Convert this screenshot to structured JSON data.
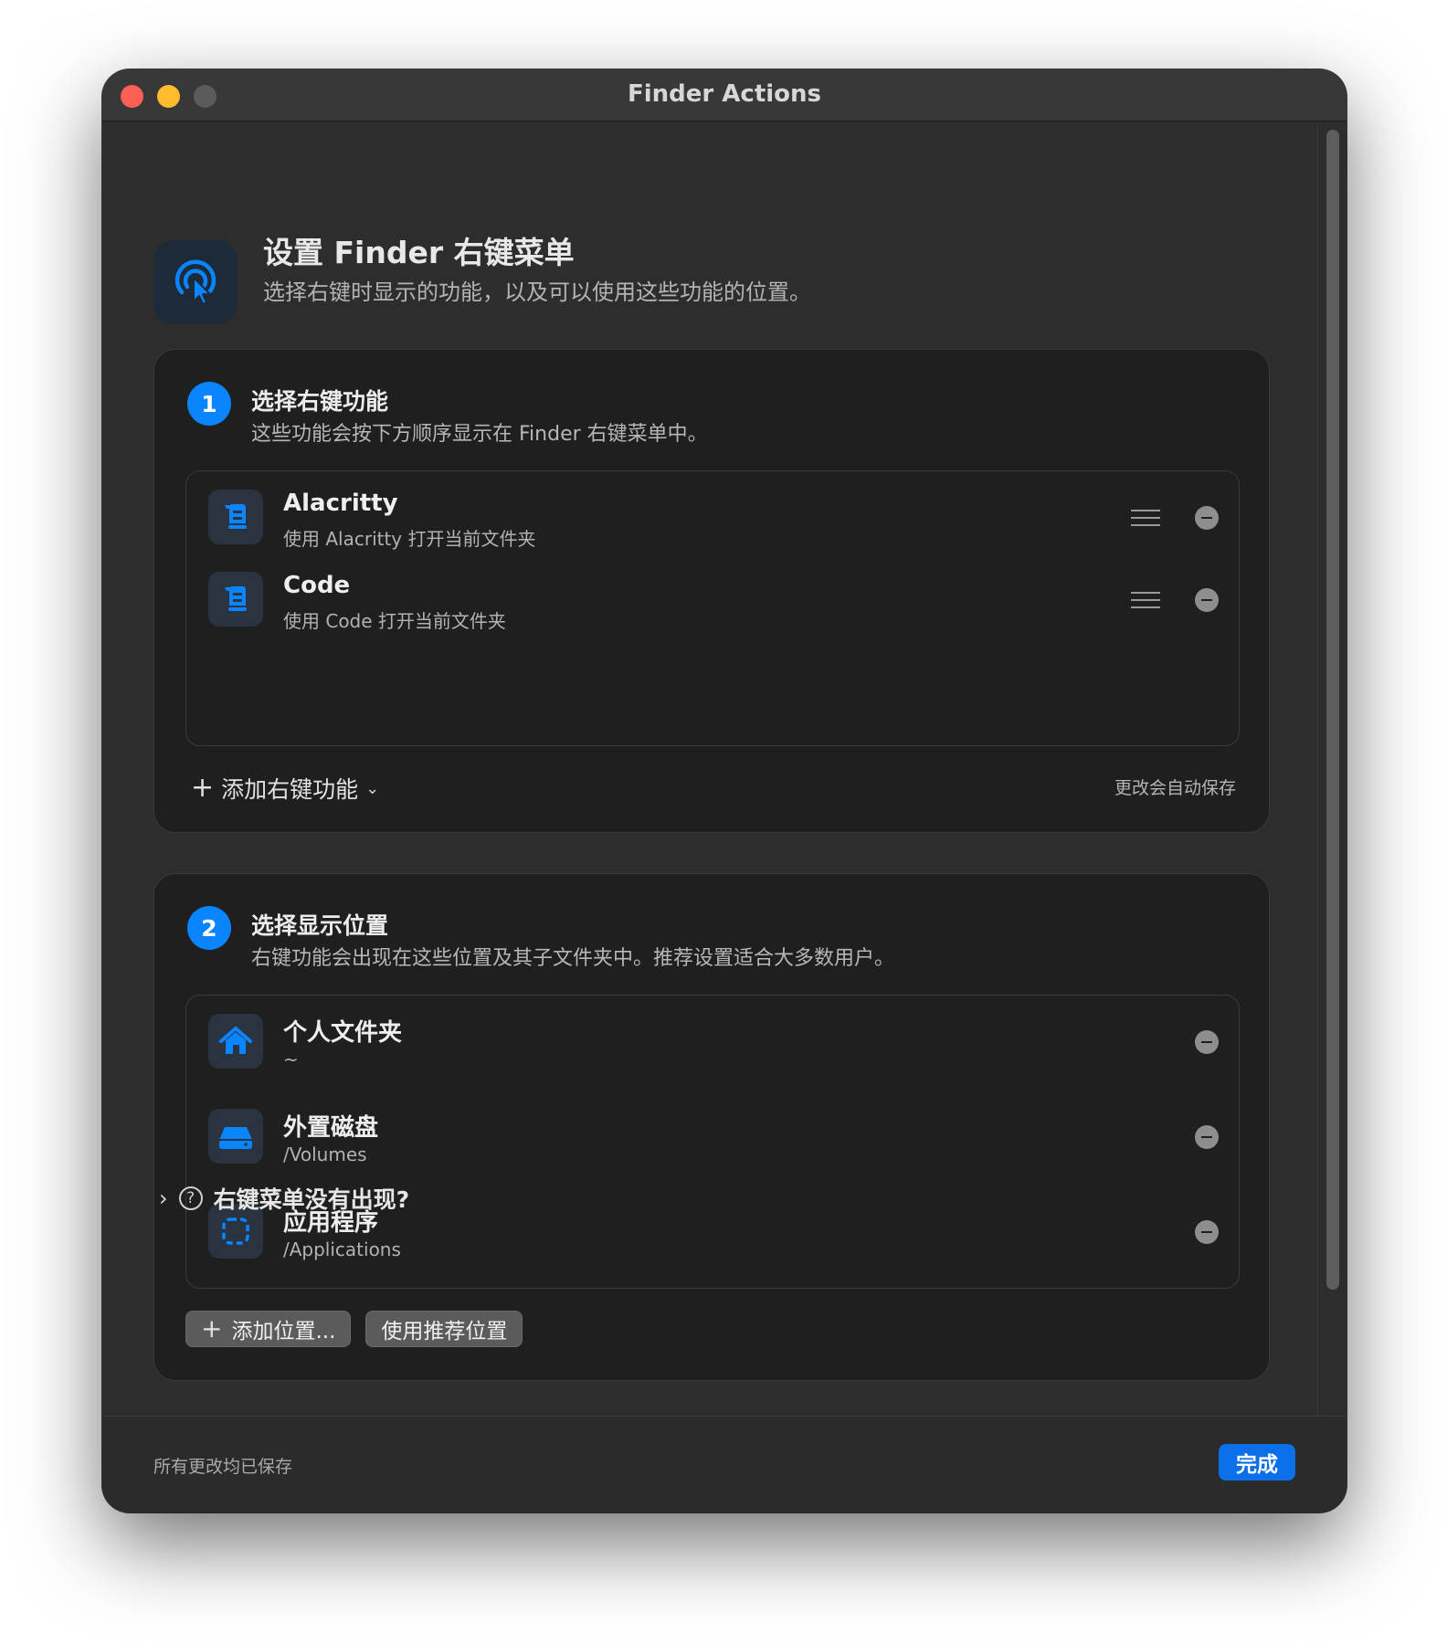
{
  "window": {
    "title": "Finder Actions"
  },
  "header": {
    "icon": "tap-cursor-icon",
    "title": "设置 Finder 右键菜单",
    "subtitle": "选择右键时显示的功能，以及可以使用这些功能的位置。"
  },
  "step1": {
    "number": "1",
    "title": "选择右键功能",
    "subtitle": "这些功能会按下方顺序显示在 Finder 右键菜单中。",
    "items": [
      {
        "title": "Alacritty",
        "subtitle": "使用 Alacritty 打开当前文件夹",
        "icon": "script-icon"
      },
      {
        "title": "Code",
        "subtitle": "使用 Code 打开当前文件夹",
        "icon": "script-icon"
      }
    ],
    "add_label": "添加右键功能",
    "autosave_note": "更改会自动保存"
  },
  "step2": {
    "number": "2",
    "title": "选择显示位置",
    "subtitle": "右键功能会出现在这些位置及其子文件夹中。推荐设置适合大多数用户。",
    "items": [
      {
        "title": "个人文件夹",
        "subtitle": "~",
        "icon": "house-icon"
      },
      {
        "title": "外置磁盘",
        "subtitle": "/Volumes",
        "icon": "external-drive-icon"
      },
      {
        "title": "应用程序",
        "subtitle": "/Applications",
        "icon": "app-dashed-square-icon"
      }
    ],
    "add_location_label": "添加位置...",
    "use_recommended_label": "使用推荐位置"
  },
  "troubleshoot": {
    "label": "右键菜单没有出现?"
  },
  "footer": {
    "status": "所有更改均已保存",
    "done_label": "完成"
  },
  "colors": {
    "accent": "#0a84ff",
    "done_button": "#0a6fe8",
    "window_bg": "#2d2d2d",
    "card_bg": "#1f1f1f"
  }
}
